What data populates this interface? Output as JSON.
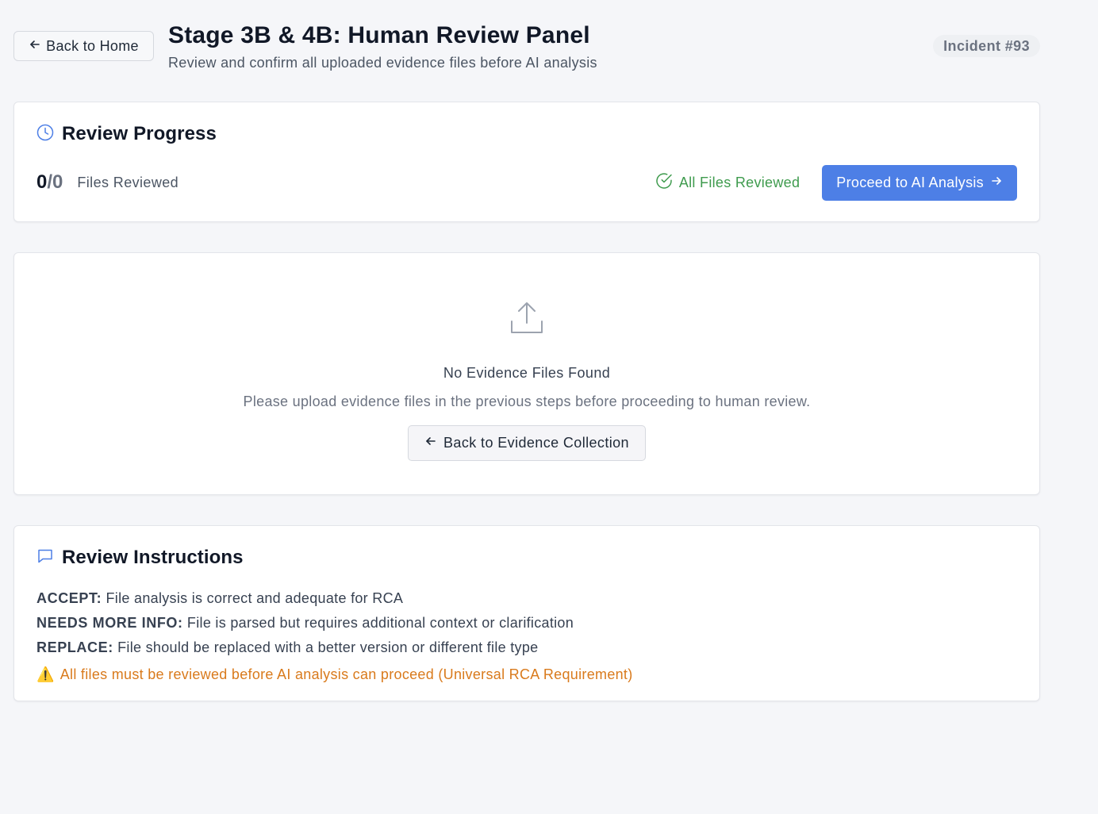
{
  "header": {
    "back_label": "Back to Home",
    "title": "Stage 3B & 4B: Human Review Panel",
    "subtitle": "Review and confirm all uploaded evidence files before AI analysis",
    "incident": "Incident #93"
  },
  "progress": {
    "title": "Review Progress",
    "reviewed": "0",
    "separator": "/",
    "total": "0",
    "files_label": "Files Reviewed",
    "status_label": "All Files Reviewed",
    "proceed_label": "Proceed to AI Analysis"
  },
  "empty_state": {
    "title": "No Evidence Files Found",
    "description": "Please upload evidence files in the previous steps before proceeding to human review.",
    "back_label": "Back to Evidence Collection"
  },
  "instructions": {
    "title": "Review Instructions",
    "items": [
      {
        "term": "ACCEPT:",
        "text": "File analysis is correct and adequate for RCA"
      },
      {
        "term": "NEEDS MORE INFO:",
        "text": "File is parsed but requires additional context or clarification"
      },
      {
        "term": "REPLACE:",
        "text": "File should be replaced with a better version or different file type"
      }
    ],
    "warning_icon": "⚠️",
    "warning": "All files must be reviewed before AI analysis can proceed (Universal RCA Requirement)"
  },
  "colors": {
    "background": "#f5f6f9",
    "primary": "#4d7fe6",
    "success": "#3f9b4e",
    "warning": "#d97a1c"
  },
  "icons": {
    "back": "arrow-left-icon",
    "progress": "clock-icon",
    "status": "check-circle-icon",
    "proceed": "arrow-right-icon",
    "empty": "upload-icon",
    "instructions": "message-square-icon",
    "warning": "warning-icon"
  }
}
